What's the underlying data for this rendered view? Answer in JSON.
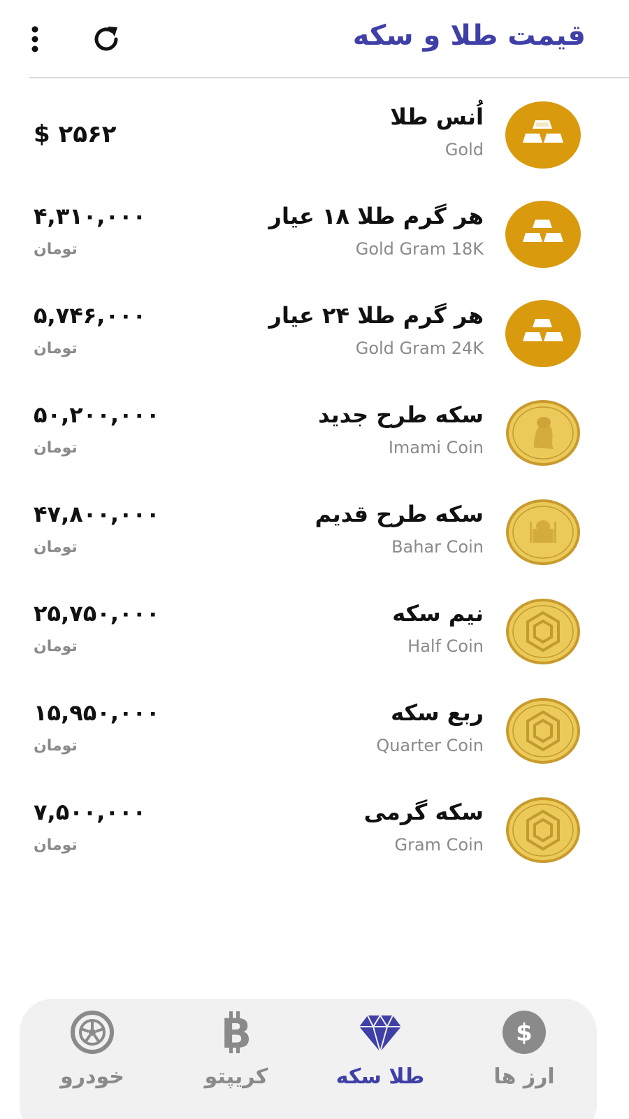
{
  "header": {
    "title": "قیمت طلا و سکه",
    "refresh_icon": "refresh-icon",
    "menu_icon": "more-vertical-icon"
  },
  "items": [
    {
      "name": "اُنس طلا",
      "subname": "Gold",
      "price": "$ ۲۵۶۲",
      "unit": "",
      "icon": "gold-bars-icon"
    },
    {
      "name": "هر گرم طلا ۱۸ عیار",
      "subname": "Gold Gram 18K",
      "price": "۴,۳۱۰,۰۰۰",
      "unit": "تومان",
      "icon": "gold-bars-icon"
    },
    {
      "name": "هر گرم طلا ۲۴ عیار",
      "subname": "Gold Gram 24K",
      "price": "۵,۷۴۶,۰۰۰",
      "unit": "تومان",
      "icon": "gold-bars-icon"
    },
    {
      "name": "سکه طرح جدید",
      "subname": "Imami Coin",
      "price": "۵۰,۲۰۰,۰۰۰",
      "unit": "تومان",
      "icon": "imami-coin-icon"
    },
    {
      "name": "سکه طرح قدیم",
      "subname": "Bahar Coin",
      "price": "۴۷,۸۰۰,۰۰۰",
      "unit": "تومان",
      "icon": "bahar-coin-icon"
    },
    {
      "name": "نیم سکه",
      "subname": "Half Coin",
      "price": "۲۵,۷۵۰,۰۰۰",
      "unit": "تومان",
      "icon": "half-coin-icon"
    },
    {
      "name": "ربع سکه",
      "subname": "Quarter Coin",
      "price": "۱۵,۹۵۰,۰۰۰",
      "unit": "تومان",
      "icon": "quarter-coin-icon"
    },
    {
      "name": "سکه گرمی",
      "subname": "Gram Coin",
      "price": "۷,۵۰۰,۰۰۰",
      "unit": "تومان",
      "icon": "gram-coin-icon"
    }
  ],
  "nav": {
    "currency": {
      "label": "ارز ها",
      "icon": "dollar-icon"
    },
    "gold": {
      "label": "طلا سکه",
      "icon": "diamond-icon"
    },
    "crypto": {
      "label": "کریپتو",
      "icon": "bitcoin-icon"
    },
    "car": {
      "label": "خودرو",
      "icon": "wheel-icon"
    }
  },
  "colors": {
    "accent": "#3f3fa8",
    "gold": "#d99a0e",
    "coin": "#e8c24a",
    "muted": "#8a8a8a",
    "nav_bg": "#f1f1f1"
  }
}
